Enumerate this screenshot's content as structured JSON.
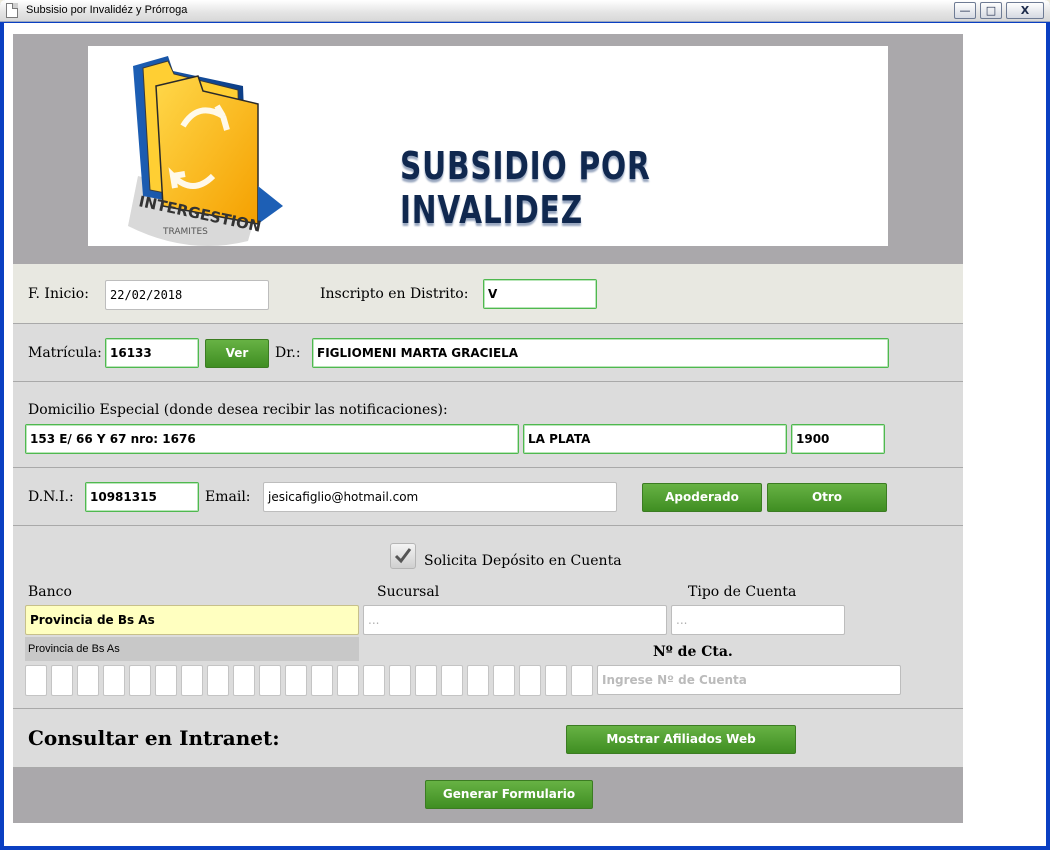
{
  "window": {
    "title": "Subsisio por Invalidéz y Prórroga",
    "controls": {
      "minimize": "—",
      "maximize": "□",
      "close": "X"
    }
  },
  "banner": {
    "logo_text": "INTERGESTION",
    "logo_subtext": "TRAMITES",
    "title": "SUBSIDIO POR INVALIDEZ"
  },
  "form": {
    "fecha_inicio": {
      "label": "F. Inicio:",
      "value": "22/02/2018"
    },
    "distrito": {
      "label": "Inscripto en Distrito:",
      "value": "V"
    },
    "matricula": {
      "label": "Matrícula:",
      "value": "16133",
      "ver_button": "Ver"
    },
    "doctor": {
      "label": "Dr.:",
      "value": "FIGLIOMENI MARTA GRACIELA"
    },
    "domicilio": {
      "label": "Domicilio Especial (donde desea recibir las notificaciones):",
      "direccion": "153 E/ 66 Y 67 nro: 1676",
      "localidad": "LA PLATA",
      "cp": "1900"
    },
    "dni": {
      "label": "D.N.I.:",
      "value": "10981315"
    },
    "email": {
      "label": "Email:",
      "value": "jesicafiglio@hotmail.com"
    },
    "apoderado_button": "Apoderado",
    "otro_button": "Otro",
    "deposito": {
      "label": "Solicita Depósito en Cuenta",
      "checked": true,
      "banco_label": "Banco",
      "banco_value": "Provincia de Bs As",
      "banco_suggestion": "Provincia de Bs As",
      "sucursal_label": "Sucursal",
      "sucursal_placeholder": "...",
      "tipo_label": "Tipo de Cuenta",
      "tipo_placeholder": "...",
      "nro_label": "Nº de Cta.",
      "nro_placeholder": "Ingrese Nº de Cuenta"
    },
    "intranet": {
      "label": "Consultar en Intranet:",
      "button": "Mostrar Afiliados Web"
    },
    "generar_button": "Generar Formulario"
  },
  "colors": {
    "accent_green": "#4a9a2a",
    "field_border_green": "#4fb84f",
    "highlight_yellow": "#ffffc0",
    "title_blue": "#10284f"
  }
}
